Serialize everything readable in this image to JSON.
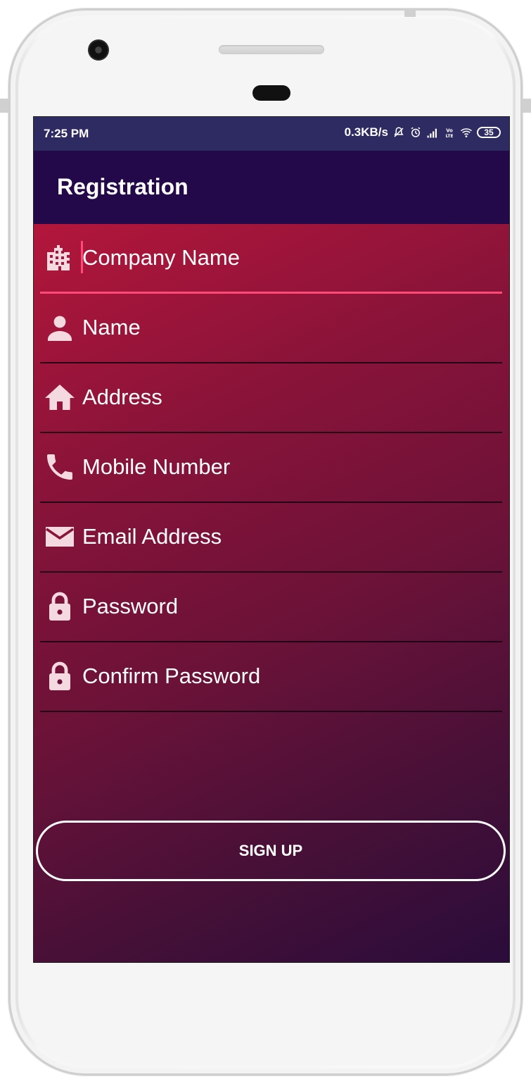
{
  "status_bar": {
    "time": "7:25 PM",
    "net_speed": "0.3KB/s",
    "battery": "35"
  },
  "app_bar": {
    "title": "Registration"
  },
  "form": {
    "fields": [
      {
        "placeholder": "Company Name",
        "icon": "company-building-icon"
      },
      {
        "placeholder": "Name",
        "icon": "person-icon"
      },
      {
        "placeholder": "Address",
        "icon": "home-icon"
      },
      {
        "placeholder": "Mobile Number",
        "icon": "phone-icon"
      },
      {
        "placeholder": "Email Address",
        "icon": "mail-icon"
      },
      {
        "placeholder": "Password",
        "icon": "lock-icon"
      },
      {
        "placeholder": "Confirm Password",
        "icon": "lock-icon"
      }
    ],
    "submit_label": "SIGN UP"
  },
  "colors": {
    "status_bar": "#2e2a62",
    "app_bar": "#23084a",
    "gradient_start": "#b3163b",
    "gradient_end": "#2a0c3b",
    "focus_accent": "#ff4a78",
    "icon_tint": "#f4d9e1"
  }
}
